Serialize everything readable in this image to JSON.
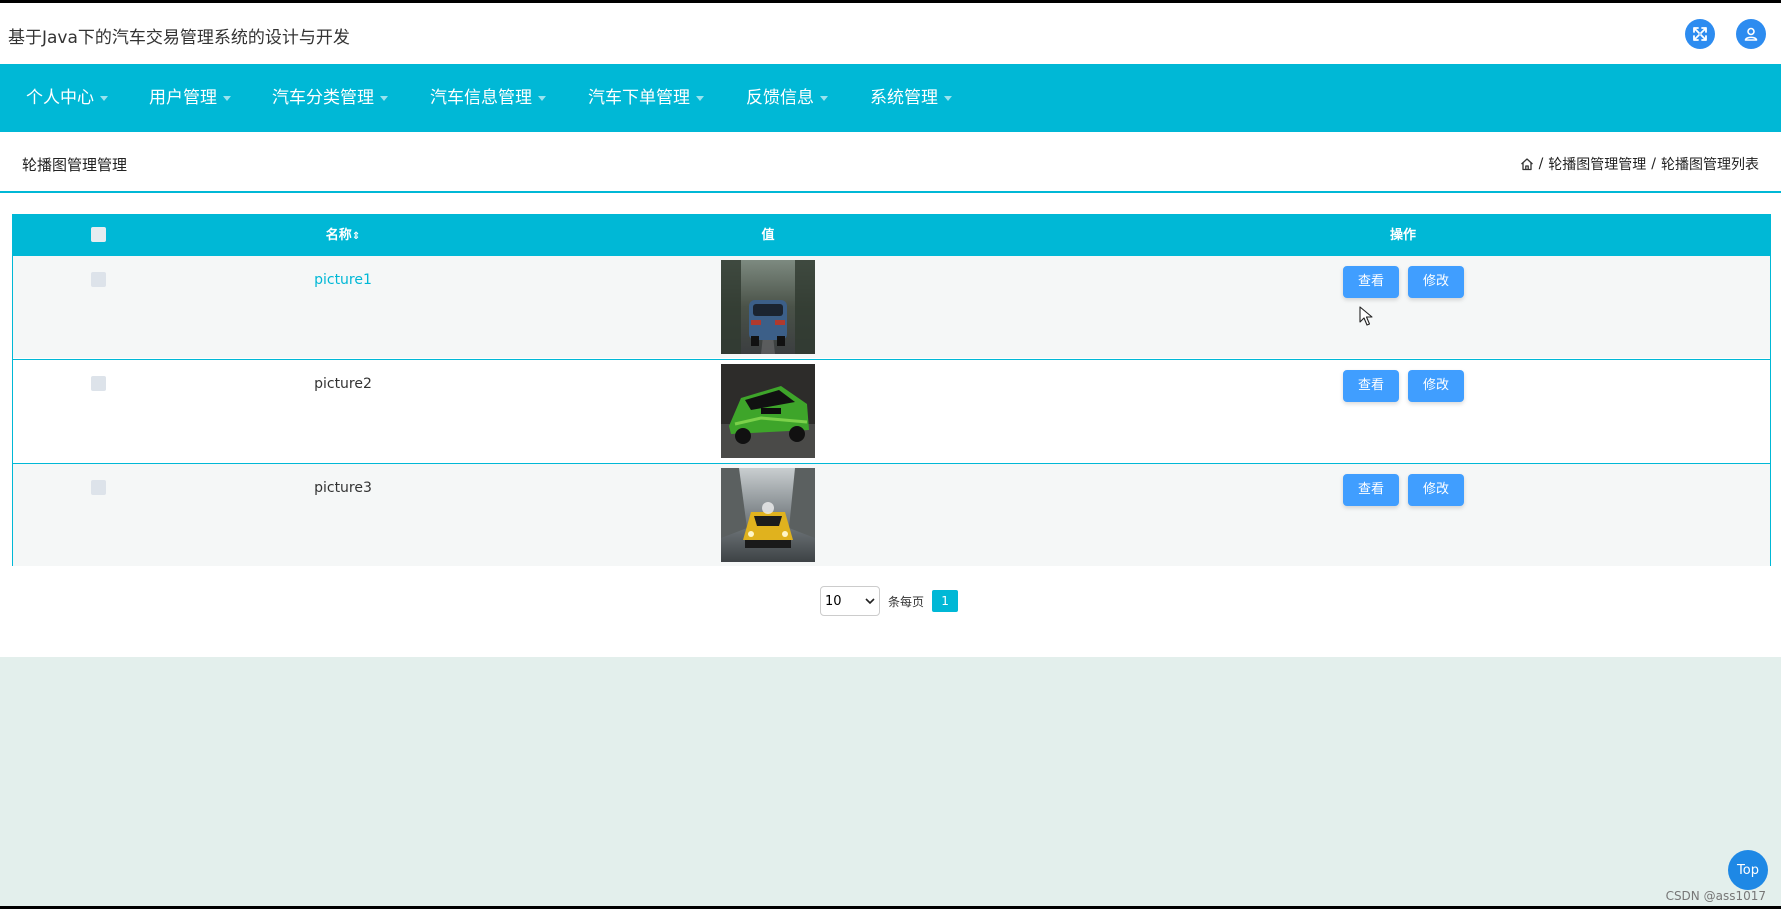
{
  "header": {
    "title": "基于Java下的汽车交易管理系统的设计与开发"
  },
  "nav": {
    "items": [
      {
        "label": "个人中心"
      },
      {
        "label": "用户管理"
      },
      {
        "label": "汽车分类管理"
      },
      {
        "label": "汽车信息管理"
      },
      {
        "label": "汽车下单管理"
      },
      {
        "label": "反馈信息"
      },
      {
        "label": "系统管理"
      }
    ]
  },
  "page": {
    "title": "轮播图管理管理",
    "breadcrumb": [
      "轮播图管理管理",
      "轮播图管理列表"
    ],
    "breadcrumb_sep": "/"
  },
  "table": {
    "columns": [
      "名称",
      "值",
      "操作"
    ],
    "sort_glyph": "⇕",
    "rows": [
      {
        "name": "picture1",
        "image": "blue-car-rear-photo"
      },
      {
        "name": "picture2",
        "image": "green-sports-car-photo"
      },
      {
        "name": "picture3",
        "image": "yellow-car-front-photo"
      }
    ],
    "view_label": "查看",
    "edit_label": "修改"
  },
  "pager": {
    "page_size": "10",
    "per_page_text": "条每页",
    "current_page": "1"
  },
  "back_to_top": "Top",
  "watermark": "CSDN @ass1017",
  "colors": {
    "accent": "#00b8d6",
    "button": "#409eff",
    "icon_button": "#2d8cf0",
    "page_bg": "#e3efec"
  }
}
